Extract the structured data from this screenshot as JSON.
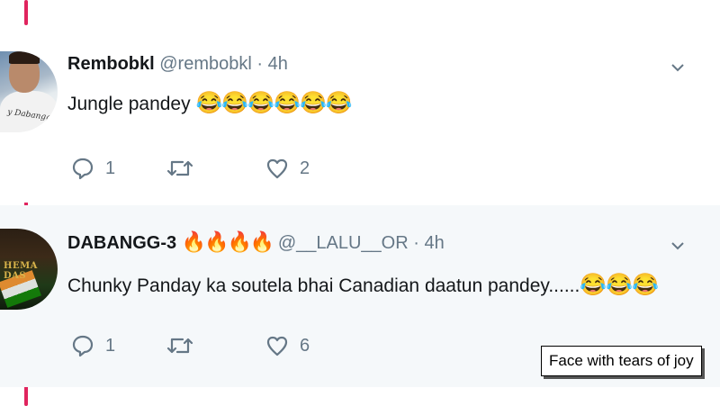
{
  "tweets": [
    {
      "name": "Rembobkl",
      "handle": "@rembobkl",
      "time": "4h",
      "text": "Jungle pandey",
      "emojis": "😂😂😂😂😂😂",
      "avatar_text": "y Dabangg",
      "replies": "1",
      "retweets": "",
      "likes": "2"
    },
    {
      "name": "DABANGG-3",
      "name_emojis": "🔥🔥🔥🔥",
      "handle": "@__LALU__OR",
      "time": "4h",
      "text": "Chunky Panday ka soutela bhai Canadian daatun pandey......",
      "emojis": "😂😂😂",
      "avatar_text": "HEMA DAS",
      "replies": "1",
      "retweets": "",
      "likes": "6"
    }
  ],
  "tooltip": "Face with tears of joy",
  "colors": {
    "thread_line": "#e0245e",
    "secondary_text": "#657786",
    "highlight_bg": "#f5f8fa"
  },
  "icons": {
    "reply": "reply-icon",
    "retweet": "retweet-icon",
    "like": "like-icon",
    "menu": "chevron-down-icon"
  }
}
